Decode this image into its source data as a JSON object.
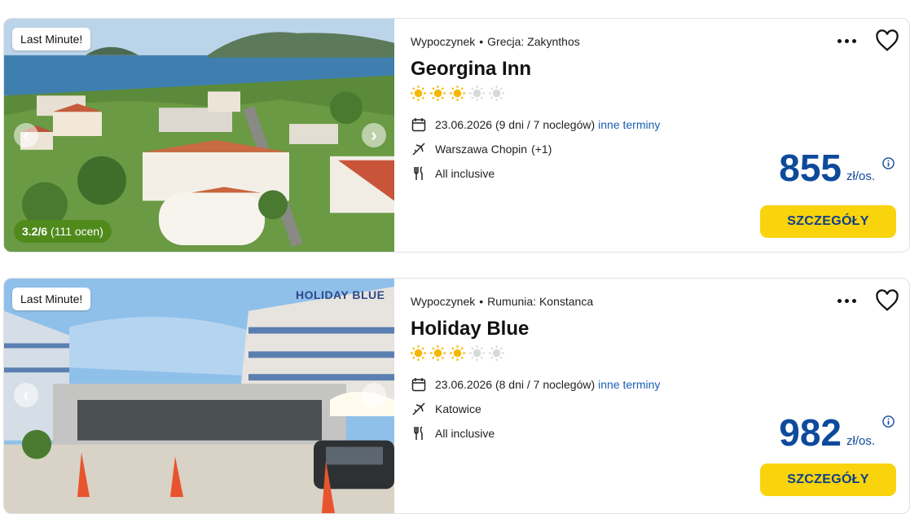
{
  "offers": [
    {
      "badge": "Last Minute!",
      "category": "Wypoczynek",
      "location": "Grecja: Zakynthos",
      "name": "Georgina Inn",
      "stars_filled": 3,
      "stars_total": 5,
      "date_text": "23.06.2026 (9 dni / 7 noclegów)",
      "other_dates_link": "inne terminy",
      "departure": "Warszawa Chopin",
      "departure_extra": "(+1)",
      "board": "All inclusive",
      "price": "855",
      "price_unit": "zł/os.",
      "details_button": "SZCZEGÓŁY",
      "rating_score": "3.2/6",
      "rating_count": "(111 ocen)"
    },
    {
      "badge": "Last Minute!",
      "category": "Wypoczynek",
      "location": "Rumunia: Konstanca",
      "name": "Holiday Blue",
      "stars_filled": 3,
      "stars_total": 5,
      "date_text": "23.06.2026 (8 dni / 7 noclegów)",
      "other_dates_link": "inne terminy",
      "departure": "Katowice",
      "departure_extra": "",
      "board": "All inclusive",
      "price": "982",
      "price_unit": "zł/os.",
      "details_button": "SZCZEGÓŁY",
      "hotel_sign": "HOLIDAY BLUE"
    }
  ],
  "icons": {
    "calendar": "calendar-icon",
    "plane": "plane-icon",
    "food": "cutlery-icon",
    "more": "more-options-icon",
    "heart": "heart-icon",
    "info": "info-icon",
    "star": "sun-star-icon"
  },
  "colors": {
    "price": "#0e4a9c",
    "link": "#1a5fb4",
    "button": "#f9d30c",
    "button_text": "#0e3f8c",
    "rating": "#4f8a1b",
    "star_on": "#f5b800",
    "star_off": "#d9d9d9"
  }
}
